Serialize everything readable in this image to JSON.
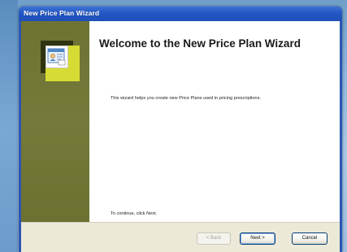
{
  "window": {
    "title": "New Price Plan Wizard"
  },
  "wizard": {
    "heading": "Welcome to the New Price Plan Wizard",
    "description": "This wizard helps you create new Price Plans used in pricing prescriptions.",
    "continue_hint": "To continue, click Next.",
    "side_icon": "price-plan-document-icon"
  },
  "buttons": {
    "back_label": "< Back",
    "next_label": "Next >",
    "cancel_label": "Cancel"
  },
  "colors": {
    "titlebar": "#2457c4",
    "side_panel": "#6e7333",
    "accent": "#d6dc33",
    "button_bar": "#ece9d8"
  }
}
